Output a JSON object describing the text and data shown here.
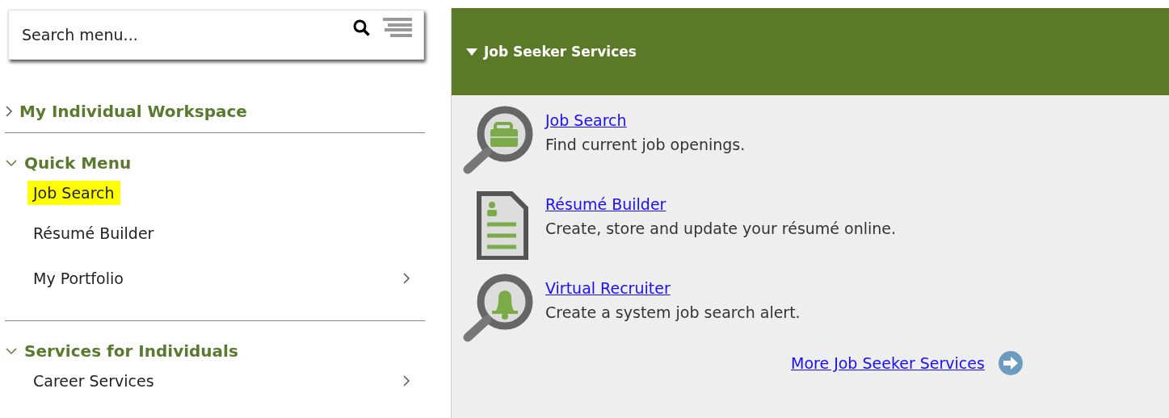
{
  "search": {
    "placeholder": "Search menu..."
  },
  "sections": [
    {
      "title": "My Individual Workspace",
      "expanded": false
    },
    {
      "title": "Quick Menu",
      "expanded": true,
      "items": [
        {
          "label": "Job Search",
          "selected": true,
          "has_submenu": false
        },
        {
          "label": "Résumé Builder",
          "selected": false,
          "has_submenu": false
        },
        {
          "label": "My Portfolio",
          "selected": false,
          "has_submenu": true
        }
      ]
    },
    {
      "title": "Services for Individuals",
      "expanded": true,
      "items": [
        {
          "label": "Career Services",
          "selected": false,
          "has_submenu": true
        }
      ]
    }
  ],
  "panel": {
    "title": "Job Seeker Services",
    "expanded": true,
    "services": [
      {
        "kind": "briefcase",
        "link": "Job Search",
        "description": "Find current job openings."
      },
      {
        "kind": "document",
        "link": "Résumé Builder",
        "description": "Create, store and update your résumé online."
      },
      {
        "kind": "bell",
        "link": "Virtual Recruiter",
        "description": "Create a system job search alert."
      }
    ],
    "more_link": "More Job Seeker Services"
  }
}
